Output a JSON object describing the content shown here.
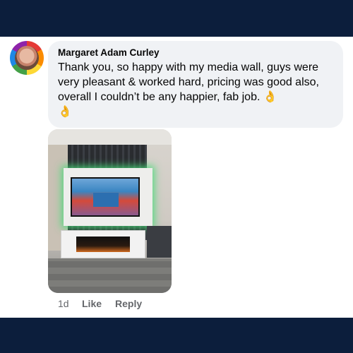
{
  "comment": {
    "author": "Margaret Adam Curley",
    "text": "Thank you, so happy with my media wall, guys were very pleasant & worked hard, pricing was good also, overall I couldn’t be any happier, fab job.",
    "emoji_inline": "👌",
    "emoji_trailing": "👌",
    "avatar_icon": "rainbow-profile-avatar"
  },
  "photo": {
    "subject": "media wall with mounted TV and electric fireplace"
  },
  "actions": {
    "time": "1d",
    "like_label": "Like",
    "reply_label": "Reply"
  },
  "colors": {
    "band": "#0c1e3c",
    "bubble": "#f0f2f5",
    "meta_text": "#65676b"
  }
}
